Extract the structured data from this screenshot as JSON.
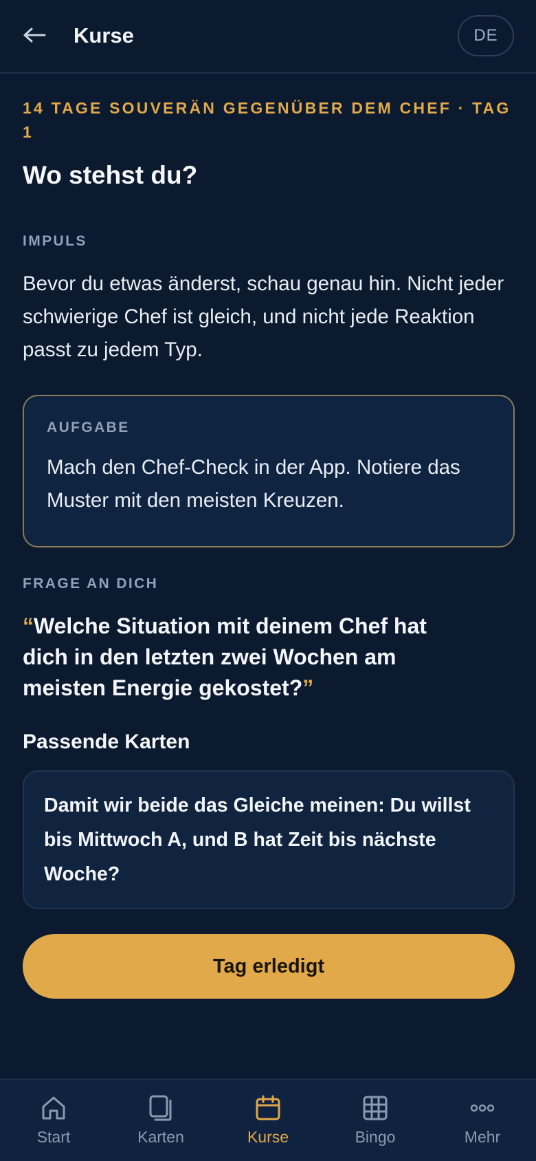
{
  "header": {
    "back_icon": "arrow-left-icon",
    "title": "Kurse",
    "language": "DE"
  },
  "course": {
    "eyebrow": "14 TAGE SOUVERÄN GEGENÜBER DEM CHEF · TAG 1",
    "day_title": "Wo stehst du?"
  },
  "impuls": {
    "label": "IMPULS",
    "text": "Bevor du etwas änderst, schau genau hin. Nicht jeder schwierige Chef ist gleich, und nicht jede Reaktion passt zu jedem Typ."
  },
  "task": {
    "label": "AUFGABE",
    "text": "Mach den Chef-Check in der App. Notiere das Muster mit den meisten Kreuzen."
  },
  "question": {
    "label": "FRAGE AN DICH",
    "open_quote": "“",
    "text": "Welche Situation mit deinem Chef hat dich in den letzten zwei Wochen am meisten Energie gekostet?",
    "close_quote": "”"
  },
  "cards": {
    "heading": "Passende Karten",
    "items": [
      {
        "text": "Damit wir beide das Gleiche meinen: Du willst bis Mittwoch A, und B hat Zeit bis nächste Woche?"
      }
    ]
  },
  "actions": {
    "done_label": "Tag erledigt"
  },
  "nav": {
    "active": "Kurse",
    "accent_color": "#e2a94a",
    "items": [
      {
        "label": "Start",
        "icon": "home-icon"
      },
      {
        "label": "Karten",
        "icon": "cards-icon"
      },
      {
        "label": "Kurse",
        "icon": "calendar-icon"
      },
      {
        "label": "Bingo",
        "icon": "grid-icon"
      },
      {
        "label": "Mehr",
        "icon": "more-icon"
      }
    ]
  }
}
